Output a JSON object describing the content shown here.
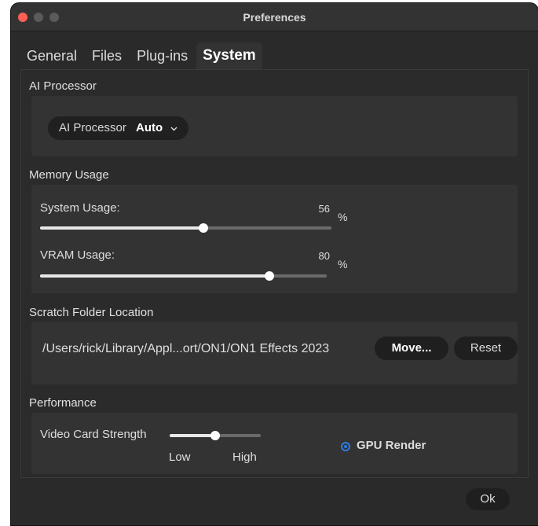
{
  "window": {
    "title": "Preferences"
  },
  "tabs": [
    {
      "label": "General",
      "active": false
    },
    {
      "label": "Files",
      "active": false
    },
    {
      "label": "Plug-ins",
      "active": false
    },
    {
      "label": "System",
      "active": true
    }
  ],
  "ai_processor": {
    "section_label": "AI Processor",
    "dropdown_label": "AI Processor",
    "dropdown_value": "Auto"
  },
  "memory": {
    "section_label": "Memory Usage",
    "system_label": "System Usage:",
    "system_value": "56",
    "system_level": 0.56,
    "vram_label": "VRAM Usage:",
    "vram_value": "80",
    "vram_level": 0.8,
    "unit": "%"
  },
  "scratch": {
    "section_label": "Scratch Folder Location",
    "path": "/Users/rick/Library/Appl...ort/ON1/ON1 Effects 2023",
    "move_label": "Move...",
    "reset_label": "Reset"
  },
  "performance": {
    "section_label": "Performance",
    "video_card_label": "Video Card Strength",
    "video_card_level": 0.5,
    "low_label": "Low",
    "high_label": "High",
    "gpu_render_label": "GPU Render",
    "gpu_render_selected": true
  },
  "footer": {
    "ok_label": "Ok"
  },
  "colors": {
    "accent": "#2f7be0",
    "close": "#ff5f57",
    "window_bg": "#2a2a2a"
  }
}
